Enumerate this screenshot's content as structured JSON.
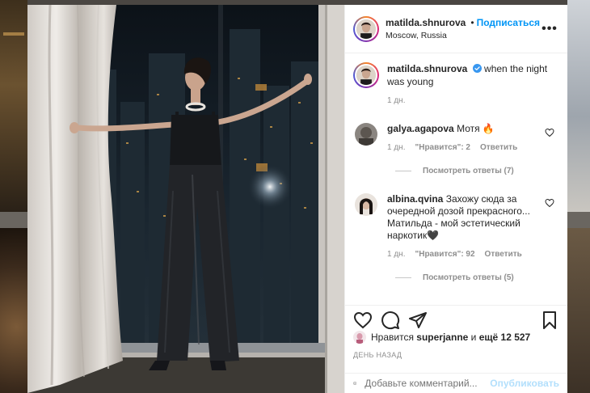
{
  "post": {
    "username": "matilda.shnurova",
    "follow_label": "Подписаться",
    "dot": "•",
    "location": "Moscow, Russia",
    "more_glyph": "•••",
    "caption": "when the night was young",
    "posted_ago": "1 дн."
  },
  "comments": [
    {
      "username": "galya.agapova",
      "text": "Мотя 🔥",
      "time": "1 дн.",
      "likes": "\"Нравится\": 2",
      "reply": "Ответить",
      "view_replies": "Посмотреть ответы (7)"
    },
    {
      "username": "albina.qvina",
      "text": "Захожу сюда за очередной дозой прекрасного... Матильда - мой эстетический наркотик🖤",
      "time": "1 дн.",
      "likes": "\"Нравится\": 92",
      "reply": "Ответить",
      "view_replies": "Посмотреть ответы (5)"
    }
  ],
  "likes_line": {
    "prefix": "Нравится",
    "user": "superjanne",
    "middle": "и",
    "rest": "ещё 12 527"
  },
  "date_label": "ДЕНЬ НАЗАД",
  "add_comment": {
    "placeholder": "Добавьте комментарий...",
    "publish": "Опубликовать"
  },
  "icons": {
    "verified": "verified-badge-icon",
    "like": "heart-icon",
    "comment": "comment-icon",
    "share": "paper-plane-icon",
    "save": "bookmark-icon",
    "emoji": "smiley-icon"
  },
  "colors": {
    "accent": "#0095f6",
    "muted": "#8e8e8e",
    "publish_disabled": "#b2dffc"
  }
}
